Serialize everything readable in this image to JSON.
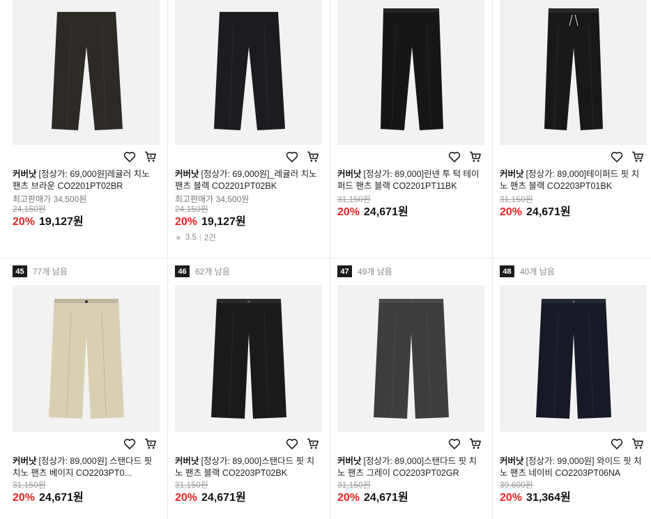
{
  "products": [
    {
      "rank": "",
      "stock": "",
      "brand": "커버낫",
      "title": "[정상가: 69,000원]레귤러 치노 팬츠 브라운 CO2201PT02BR",
      "best_price": "최고판매가 34,500원",
      "original_price": "24,150원",
      "discount": "20%",
      "price": "19,127원",
      "rating": "",
      "reviews": "",
      "color": "#2d2a26",
      "style": "regular"
    },
    {
      "rank": "",
      "stock": "",
      "brand": "커버낫",
      "title": "[정상가: 69,000원]_레귤러 치노 팬츠 블랙 CO2201PT02BK",
      "best_price": "최고판매가 34,500원",
      "original_price": "24,150원",
      "discount": "20%",
      "price": "19,127원",
      "rating": "3.5",
      "reviews": "2건",
      "color": "#1b1c20",
      "style": "regular"
    },
    {
      "rank": "",
      "stock": "",
      "brand": "커버낫",
      "title": "[정상가: 89,000]린넨 투 턱 테이퍼드 팬츠 블랙 CO2201PT11BK",
      "best_price": "",
      "original_price": "31,150원",
      "discount": "20%",
      "price": "24,671원",
      "rating": "",
      "reviews": "",
      "color": "#161616",
      "style": "tapered"
    },
    {
      "rank": "",
      "stock": "",
      "brand": "커버낫",
      "title": "[정상가: 89,000]테이퍼드 핏 치노 팬츠 블랙 CO2203PT01BK",
      "best_price": "",
      "original_price": "31,150원",
      "discount": "20%",
      "price": "24,671원",
      "rating": "",
      "reviews": "",
      "color": "#18181a",
      "style": "drawstring"
    },
    {
      "rank": "45",
      "stock": "77개 남음",
      "brand": "커버낫",
      "title": "[정상가: 89,000원] 스탠다드 핏 치노 팬츠 베이지 CO2203PT0...",
      "best_price": "",
      "original_price": "31,150원",
      "discount": "20%",
      "price": "24,671원",
      "rating": "",
      "reviews": "",
      "color": "#d9cfb3",
      "style": "wide"
    },
    {
      "rank": "46",
      "stock": "62개 남음",
      "brand": "커버낫",
      "title": "[정상가: 89,000]스탠다드 핏 치노 팬츠 블랙 CO2203PT02BK",
      "best_price": "",
      "original_price": "31,150원",
      "discount": "20%",
      "price": "24,671원",
      "rating": "",
      "reviews": "",
      "color": "#1a1a1c",
      "style": "wide"
    },
    {
      "rank": "47",
      "stock": "49개 남음",
      "brand": "커버낫",
      "title": "[정상가: 89,000]스탠다드 핏 치노 팬츠 그레이 CO2203PT02GR",
      "best_price": "",
      "original_price": "31,150원",
      "discount": "20%",
      "price": "24,671원",
      "rating": "",
      "reviews": "",
      "color": "#3d3d3d",
      "style": "wide"
    },
    {
      "rank": "48",
      "stock": "40개 남음",
      "brand": "커버낫",
      "title": "[정상가: 99,000원] 와이드 핏 치노 팬츠 네이비 CO2203PT06NA",
      "best_price": "",
      "original_price": "39,600원",
      "discount": "20%",
      "price": "31,364원",
      "rating": "",
      "reviews": "",
      "color": "#161a26",
      "style": "wide"
    }
  ],
  "icons": {
    "wishlist": "heart-icon",
    "cart": "cart-icon",
    "rating": "star-icon"
  }
}
